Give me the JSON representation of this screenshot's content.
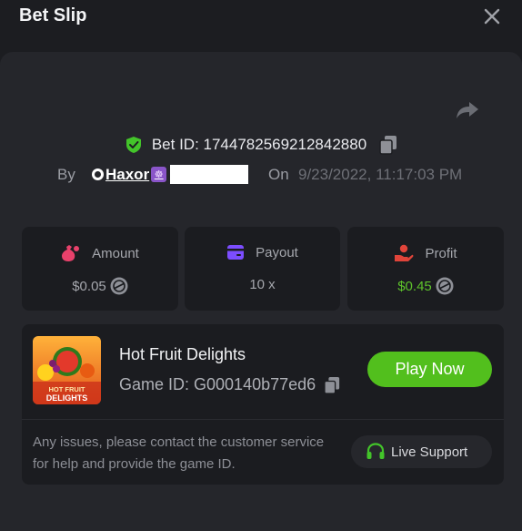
{
  "header": {
    "title": "Bet Slip"
  },
  "bet": {
    "id_text": "Bet ID: 1744782569212842880",
    "by_label": "By",
    "username": "Haxor",
    "vip_badge": "☸",
    "on_label": "On",
    "datetime": "9/23/2022, 11:17:03 PM"
  },
  "stats": {
    "amount": {
      "label": "Amount",
      "value": "$0.05"
    },
    "payout": {
      "label": "Payout",
      "value": "10 x"
    },
    "profit": {
      "label": "Profit",
      "value": "$0.45"
    }
  },
  "game": {
    "name": "Hot Fruit Delights",
    "id_text": "Game ID: G000140b77ed6",
    "thumb_title_line1": "HOT FRUIT",
    "thumb_title_line2": "DELIGHTS",
    "play_label": "Play Now",
    "issues_text": "Any issues, please contact the customer service for help and provide the game ID.",
    "support_label": "Live Support"
  },
  "colors": {
    "accent_green": "#52bf1d",
    "profit_green": "#5dc22b",
    "amount_pink": "#e8416b",
    "payout_purple": "#7c4dff",
    "profit_red": "#e0443a",
    "shield_green": "#43c42a"
  },
  "icons": {
    "close": "close-icon",
    "share": "share-icon",
    "shield": "shield-check-icon",
    "copy": "copy-icon",
    "amount": "money-bag-icon",
    "payout": "wallet-card-icon",
    "profit": "hand-coin-icon",
    "coin": "coin-icon",
    "support": "headset-icon"
  }
}
